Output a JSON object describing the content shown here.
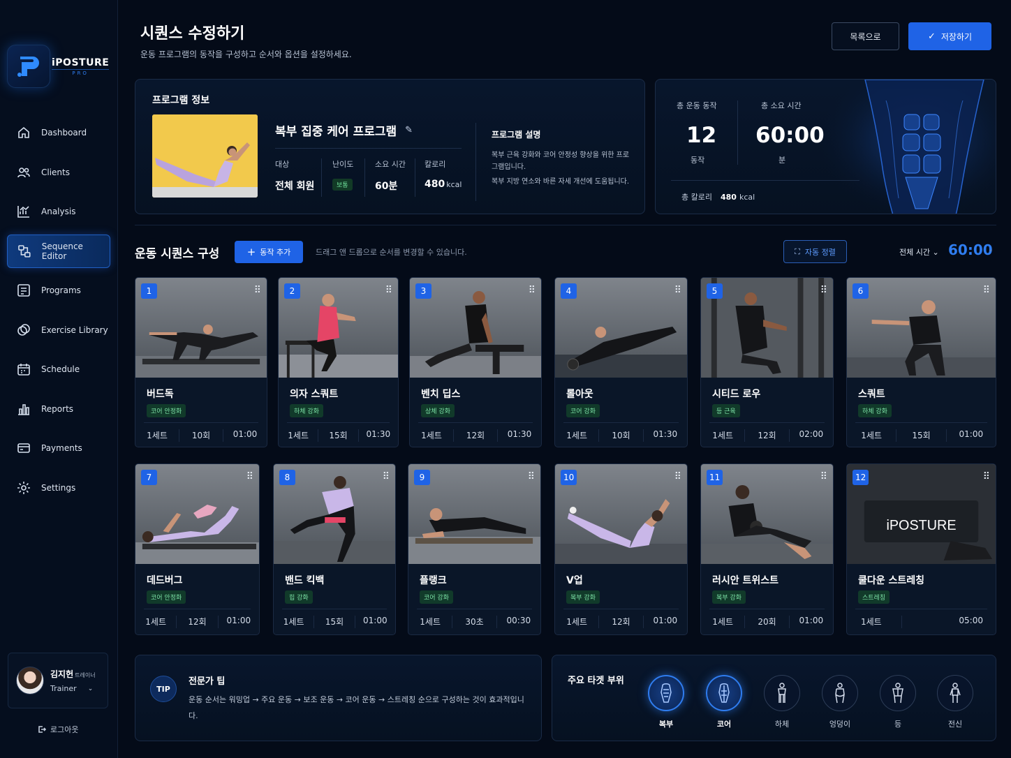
{
  "app": {
    "brand": "iPOSTURE",
    "brand_sub": "PRO"
  },
  "sidebar": {
    "items": [
      {
        "label": "Dashboard",
        "icon": "home-icon"
      },
      {
        "label": "Clients",
        "icon": "users-icon"
      },
      {
        "label": "Analysis",
        "icon": "chart-icon"
      },
      {
        "label": "Sequence Editor",
        "icon": "sequence-icon",
        "active": true
      },
      {
        "label": "Programs",
        "icon": "programs-icon"
      },
      {
        "label": "Exercise Library",
        "icon": "library-icon"
      },
      {
        "label": "Schedule",
        "icon": "calendar-icon"
      },
      {
        "label": "Reports",
        "icon": "reports-icon"
      },
      {
        "label": "Payments",
        "icon": "payment-icon"
      },
      {
        "label": "Settings",
        "icon": "gear-icon"
      }
    ],
    "user": {
      "name": "김지헌",
      "title": "트레이너",
      "role": "Trainer"
    },
    "logout": "로그아웃"
  },
  "header": {
    "title": "시퀀스 수정하기",
    "subtitle": "운동 프로그램의 동작을 구성하고 순서와 옵션을 설정하세요.",
    "back_label": "목록으로",
    "save_label": "저장하기"
  },
  "program": {
    "panel_title": "프로그램 정보",
    "name": "복부 집중 케어 프로그램",
    "target_label": "대상",
    "target_value": "전체 회원",
    "difficulty_label": "난이도",
    "difficulty_value": "보통",
    "duration_label": "소요 시간",
    "duration_value": "60분",
    "calorie_label": "칼로리",
    "calorie_value": "480",
    "calorie_unit": "kcal",
    "desc_title": "프로그램 설명",
    "desc_line1": "복부 근육 강화와 코어 안정성 향상을 위한 프로그램입니다.",
    "desc_line2": "복부 지방 연소와 바른 자세 개선에 도움됩니다."
  },
  "summary": {
    "total_moves_label": "총 운동 동작",
    "total_moves": "12",
    "total_moves_unit": "동작",
    "total_time_label": "총 소요 시간",
    "total_time": "60:00",
    "total_time_unit": "분",
    "total_cal_label": "총 칼로리",
    "total_cal": "480",
    "total_cal_unit": "kcal"
  },
  "sequence": {
    "title": "운동 시퀀스 구성",
    "add_label": "동작 추가",
    "hint": "드래그 앤 드롭으로 순서를 변경할 수 있습니다.",
    "auto_label": "자동 정렬",
    "total_label": "전체 시간",
    "total_value": "60:00"
  },
  "exercises": [
    {
      "num": "1",
      "name": "버드독",
      "tag": "코어 안정화",
      "sets": "1세트",
      "reps": "10회",
      "time": "01:00"
    },
    {
      "num": "2",
      "name": "의자 스쿼트",
      "tag": "하체 강화",
      "sets": "1세트",
      "reps": "15회",
      "time": "01:30"
    },
    {
      "num": "3",
      "name": "벤치 딥스",
      "tag": "상체 강화",
      "sets": "1세트",
      "reps": "12회",
      "time": "01:30"
    },
    {
      "num": "4",
      "name": "롤아웃",
      "tag": "코어 강화",
      "sets": "1세트",
      "reps": "10회",
      "time": "01:30"
    },
    {
      "num": "5",
      "name": "시티드 로우",
      "tag": "등 근육",
      "sets": "1세트",
      "reps": "12회",
      "time": "02:00"
    },
    {
      "num": "6",
      "name": "스쿼트",
      "tag": "하체 강화",
      "sets": "1세트",
      "reps": "15회",
      "time": "01:00"
    },
    {
      "num": "7",
      "name": "데드버그",
      "tag": "코어 안정화",
      "sets": "1세트",
      "reps": "12회",
      "time": "01:00"
    },
    {
      "num": "8",
      "name": "밴드 킥백",
      "tag": "힙 강화",
      "sets": "1세트",
      "reps": "15회",
      "time": "01:00"
    },
    {
      "num": "9",
      "name": "플랭크",
      "tag": "코어 강화",
      "sets": "1세트",
      "reps": "30초",
      "time": "00:30"
    },
    {
      "num": "10",
      "name": "V업",
      "tag": "복부 강화",
      "sets": "1세트",
      "reps": "12회",
      "time": "01:00"
    },
    {
      "num": "11",
      "name": "러시안 트위스트",
      "tag": "복부 강화",
      "sets": "1세트",
      "reps": "20회",
      "time": "01:00"
    },
    {
      "num": "12",
      "name": "쿨다운 스트레칭",
      "tag": "스트레칭",
      "sets": "1세트",
      "reps": "",
      "time": "05:00",
      "image_text": "iPOSTURE"
    }
  ],
  "tip": {
    "badge": "TIP",
    "title": "전문가 팁",
    "text": "운동 순서는 워밍업 → 주요 운동 → 보조 운동 → 코어 운동 → 스트레칭 순으로 구성하는 것이 효과적입니다."
  },
  "targets": {
    "title": "주요 타겟 부위",
    "items": [
      {
        "label": "복부",
        "active": true
      },
      {
        "label": "코어",
        "active": true
      },
      {
        "label": "하체",
        "active": false
      },
      {
        "label": "엉덩이",
        "active": false
      },
      {
        "label": "등",
        "active": false
      },
      {
        "label": "전신",
        "active": false
      }
    ]
  },
  "colors": {
    "accent": "#1f63e6",
    "accent_text": "#2f7df0",
    "background": "#040b18",
    "tag_green": "#7de3a7"
  }
}
